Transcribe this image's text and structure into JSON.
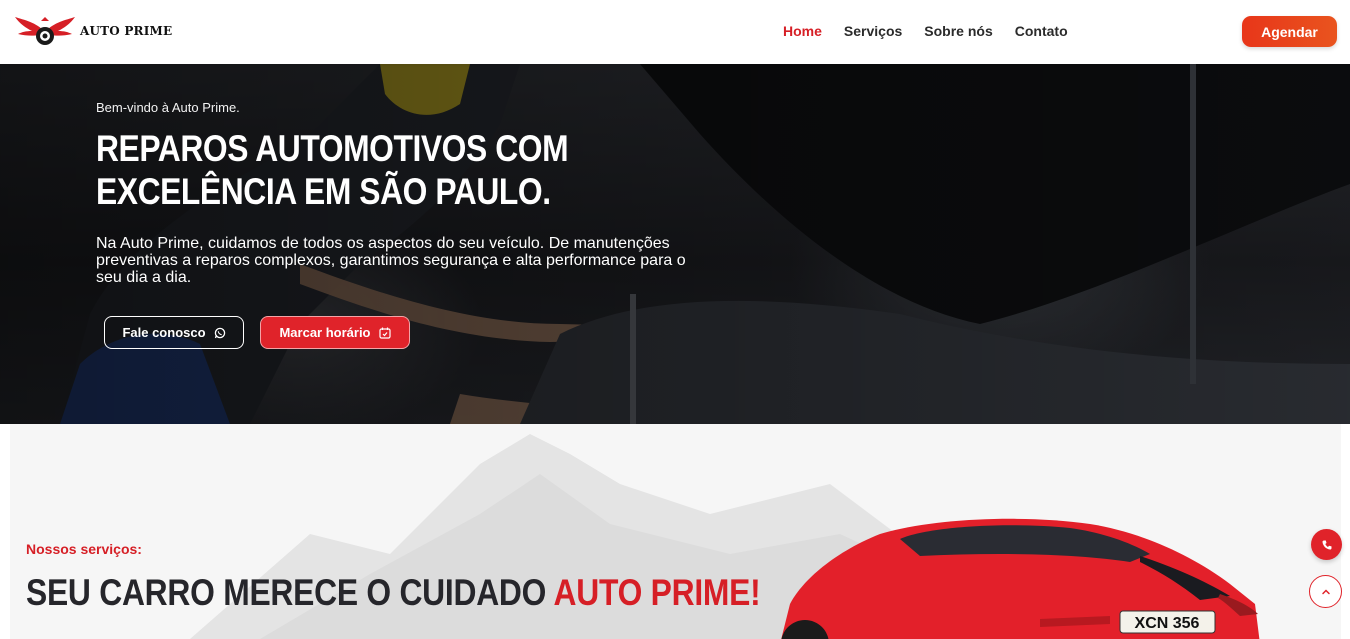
{
  "header": {
    "logo_text": "AUTO PRIME",
    "nav": [
      {
        "label": "Home",
        "active": true
      },
      {
        "label": "Serviços",
        "active": false
      },
      {
        "label": "Sobre nós",
        "active": false
      },
      {
        "label": "Contato",
        "active": false
      }
    ],
    "cta_label": "Agendar"
  },
  "hero": {
    "welcome": "Bem-vindo à Auto Prime.",
    "title": "REPAROS AUTOMOTIVOS COM EXCELÊNCIA EM SÃO PAULO.",
    "text": "Na Auto Prime, cuidamos de todos os aspectos do seu veículo. De manutenções preventivas a reparos complexos, garantimos segurança e alta performance para o seu dia a dia.",
    "btn_contact": "Fale conosco",
    "btn_schedule": "Marcar horário"
  },
  "services": {
    "subtitle": "Nossos serviços:",
    "title_main": "SEU CARRO MERECE O CUIDADO ",
    "title_accent": "AUTO PRIME!",
    "plate": "XCN 356"
  },
  "colors": {
    "accent": "#d61f26",
    "cta_gradient_start": "#e8361a",
    "cta_gradient_end": "#e9541e",
    "hero_dark": "#1b1c20",
    "section_bg": "#f6f6f6"
  },
  "icons": {
    "contact_button": "whatsapp-icon",
    "schedule_button": "calendar-check-icon",
    "float_call": "phone-icon",
    "float_scroll": "chevron-up-icon"
  }
}
